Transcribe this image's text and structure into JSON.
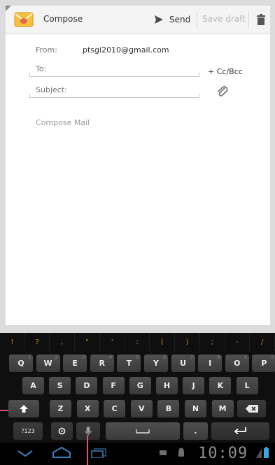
{
  "action_bar": {
    "title": "Compose",
    "send_label": "Send",
    "save_draft_label": "Save draft",
    "icons": [
      "gmail-envelope-icon",
      "send-icon",
      "trash-icon"
    ]
  },
  "compose": {
    "from_label": "From:",
    "from_value": "ptsgi2010@gmail.com",
    "to_placeholder": "To:",
    "cc_bcc_label": "+ Cc/Bcc",
    "subject_placeholder": "Subject:",
    "body_placeholder": "Compose Mail"
  },
  "keyboard": {
    "symbols": [
      "!",
      "?",
      ",",
      "\"",
      "'",
      ":",
      "(",
      ")",
      ";",
      "-",
      "/"
    ],
    "row1": [
      "Q",
      "W",
      "E",
      "R",
      "T",
      "Y",
      "U",
      "I",
      "O",
      "P"
    ],
    "row1_hints": [
      "1",
      "2",
      "3",
      "4",
      "5",
      "6",
      "7",
      "8",
      "9",
      "0"
    ],
    "row2": [
      "A",
      "S",
      "D",
      "F",
      "G",
      "H",
      "J",
      "K",
      "L"
    ],
    "row3": [
      "Z",
      "X",
      "C",
      "V",
      "B",
      "N",
      "M"
    ],
    "row4": {
      "symbols_label": "?123",
      "period_label": "."
    }
  },
  "system_bar": {
    "time": "10:09"
  }
}
